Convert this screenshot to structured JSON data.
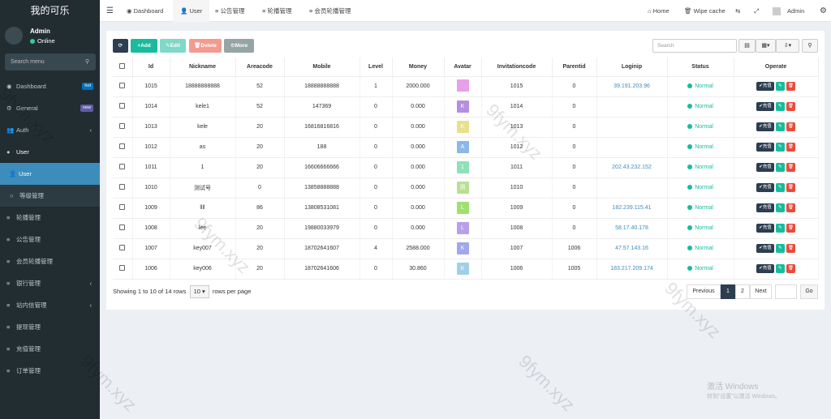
{
  "brand": "我的可乐",
  "user": {
    "name": "Admin",
    "status": "Online"
  },
  "sidebar_search": "Search menu",
  "menu": [
    {
      "label": "Dashboard",
      "badge": "hot",
      "badge_color": "#0073b7"
    },
    {
      "label": "General",
      "badge": "new",
      "badge_color": "#605ca8"
    },
    {
      "label": "Auth",
      "arrow": "‹"
    },
    {
      "label": "User"
    },
    {
      "label": "User"
    },
    {
      "label": "等级管理"
    },
    {
      "label": "轮播管理"
    },
    {
      "label": "公告管理"
    },
    {
      "label": "会员轮播管理"
    },
    {
      "label": "银行管理",
      "arrow": "‹"
    },
    {
      "label": "站内信管理",
      "arrow": "‹"
    },
    {
      "label": "提现管理"
    },
    {
      "label": "充值管理"
    },
    {
      "label": "订单管理"
    }
  ],
  "topbar": {
    "tabs": [
      "Dashboard",
      "User",
      "公告管理",
      "轮播管理",
      "会员轮播管理"
    ],
    "home": "Home",
    "wipe": "Wipe cache",
    "admin": "Admin"
  },
  "toolbar": {
    "add": "Add",
    "edit": "Edit",
    "delete": "Delete",
    "more": "More",
    "search_placeholder": "Search"
  },
  "columns": [
    "Id",
    "Nickname",
    "Areacode",
    "Mobile",
    "Level",
    "Money",
    "Avatar",
    "Invitationcode",
    "Parentid",
    "Loginip",
    "Status",
    "Operate"
  ],
  "rows": [
    {
      "id": "1015",
      "nick": "18888888888",
      "area": "52",
      "mobile": "18888888888",
      "level": "1",
      "money": "2000.000",
      "av": "",
      "avc": "#e8a0e8",
      "inv": "1015",
      "pid": "0",
      "ip": "39.191.203.96"
    },
    {
      "id": "1014",
      "nick": "kele1",
      "area": "52",
      "mobile": "147369",
      "level": "0",
      "money": "0.000",
      "av": "K",
      "avc": "#b48ee0",
      "inv": "1014",
      "pid": "0",
      "ip": ""
    },
    {
      "id": "1013",
      "nick": "kele",
      "area": "20",
      "mobile": "16816816816",
      "level": "0",
      "money": "0.000",
      "av": "K",
      "avc": "#e8e090",
      "inv": "1013",
      "pid": "0",
      "ip": ""
    },
    {
      "id": "1012",
      "nick": "as",
      "area": "20",
      "mobile": "188",
      "level": "0",
      "money": "0.000",
      "av": "A",
      "avc": "#8ab8e8",
      "inv": "1012",
      "pid": "0",
      "ip": ""
    },
    {
      "id": "1011",
      "nick": "1",
      "area": "20",
      "mobile": "16606666666",
      "level": "0",
      "money": "0.000",
      "av": "1",
      "avc": "#90e0b8",
      "inv": "1011",
      "pid": "0",
      "ip": "202.43.232.152"
    },
    {
      "id": "1010",
      "nick": "测试号",
      "area": "0",
      "mobile": "13858888888",
      "level": "0",
      "money": "0.000",
      "av": "测",
      "avc": "#b8e090",
      "inv": "1010",
      "pid": "0",
      "ip": ""
    },
    {
      "id": "1009",
      "nick": "llll",
      "area": "86",
      "mobile": "13808531081",
      "level": "0",
      "money": "0.000",
      "av": "L",
      "avc": "#a0e070",
      "inv": "1009",
      "pid": "0",
      "ip": "182.239.115.41"
    },
    {
      "id": "1008",
      "nick": "lee",
      "area": "20",
      "mobile": "19880033979",
      "level": "0",
      "money": "0.000",
      "av": "L",
      "avc": "#b8a0e8",
      "inv": "1008",
      "pid": "0",
      "ip": "58.17.40.178"
    },
    {
      "id": "1007",
      "nick": "key007",
      "area": "20",
      "mobile": "18702641607",
      "level": "4",
      "money": "2588.000",
      "av": "K",
      "avc": "#a0a8e8",
      "inv": "1007",
      "pid": "1006",
      "ip": "47.57.143.16"
    },
    {
      "id": "1006",
      "nick": "key006",
      "area": "20",
      "mobile": "18702641606",
      "level": "0",
      "money": "30.860",
      "av": "K",
      "avc": "#a0d0e8",
      "inv": "1006",
      "pid": "1005",
      "ip": "183.217.209.174"
    }
  ],
  "status_label": "Normal",
  "op_label": "充值",
  "footer": {
    "showing": "Showing 1 to 10 of 14 rows",
    "per": "10",
    "suffix": "rows per page"
  },
  "pagination": {
    "prev": "Previous",
    "p1": "1",
    "p2": "2",
    "next": "Next",
    "go": "Go"
  },
  "watermark": "9fym.xyz",
  "windows": {
    "title": "激活 Windows",
    "sub": "转到“设置”以激活 Windows。"
  }
}
